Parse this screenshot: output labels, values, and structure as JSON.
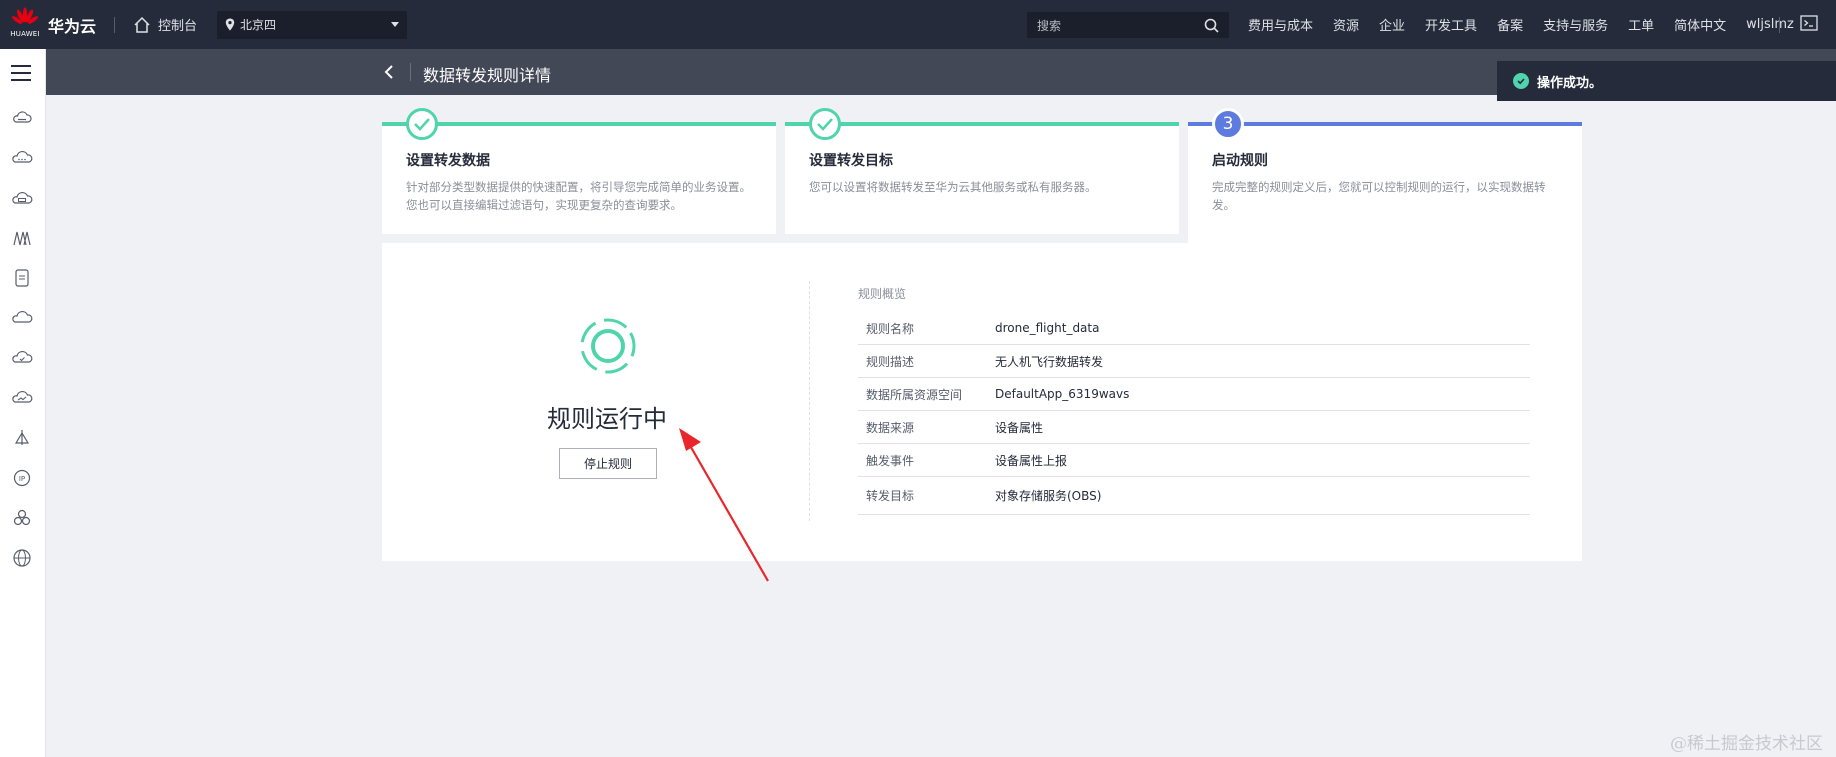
{
  "header": {
    "brand": "华为云",
    "brand_en": "HUAWEI",
    "console": "控制台",
    "region": "北京四",
    "search_placeholder": "搜索",
    "nav": [
      "费用与成本",
      "资源",
      "企业",
      "开发工具",
      "备案",
      "支持与服务",
      "工单",
      "简体中文",
      "wljslmz"
    ]
  },
  "subheader": {
    "title": "数据转发规则详情"
  },
  "toast": {
    "message": "操作成功。"
  },
  "steps": [
    {
      "index": "1",
      "title": "设置转发数据",
      "desc": "针对部分类型数据提供的快速配置，将引导您完成简单的业务设置。您也可以直接编辑过滤语句，实现更复杂的查询要求。",
      "done": true
    },
    {
      "index": "2",
      "title": "设置转发目标",
      "desc": "您可以设置将数据转发至华为云其他服务或私有服务器。",
      "done": true
    },
    {
      "index": "3",
      "title": "启动规则",
      "desc": "完成完整的规则定义后，您就可以控制规则的运行，以实现数据转发。",
      "done": false
    }
  ],
  "status": {
    "title": "规则运行中",
    "stop_button": "停止规则"
  },
  "overview": {
    "title": "规则概览",
    "rows": [
      {
        "key": "规则名称",
        "value": "drone_flight_data"
      },
      {
        "key": "规则描述",
        "value": "无人机飞行数据转发"
      },
      {
        "key": "数据所属资源空间",
        "value": "DefaultApp_6319wavs"
      },
      {
        "key": "数据来源",
        "value": "设备属性"
      },
      {
        "key": "触发事件",
        "value": "设备属性上报"
      },
      {
        "key": "转发目标",
        "value": "对象存储服务(OBS)"
      }
    ]
  },
  "watermark": "@稀土掘金技术社区",
  "colors": {
    "topbar": "#252b3a",
    "subheader": "#434857",
    "success": "#50d4ab",
    "accent": "#5e7ce0",
    "arrow": "#e8262b"
  }
}
